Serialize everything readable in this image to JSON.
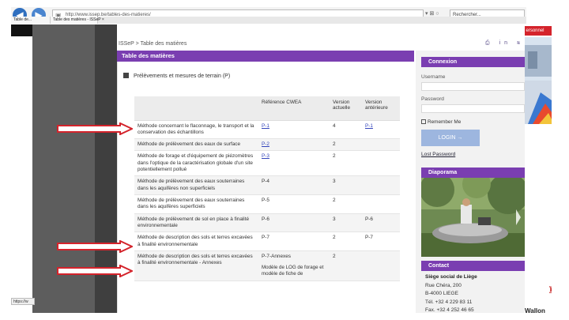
{
  "browser": {
    "back_icon": "back-arrow-icon",
    "forward_icon": "forward-arrow-icon",
    "address": "http://www.issep.be/tables-des-matieres/",
    "address_tools": "▾ ⊠ ○",
    "search_text": "Rechercher...",
    "tabs": [
      {
        "label": "Table de..."
      },
      {
        "label": "Table des matières - ISSeP ×"
      }
    ],
    "status_url": "https://w",
    "ribbon_text": "ersonnel"
  },
  "page": {
    "breadcrumb": "ISSeP > Table des matières",
    "tools_icons": [
      "print-icon",
      "linkedin-icon",
      "rss-icon",
      "search-icon"
    ],
    "tools_text": "⎙ in ≋ ⌕",
    "title": "Table des matières",
    "section_title": "Prélèvements et mesures de terrain (P)",
    "table": {
      "headers": [
        "",
        "Référence CWEA",
        "Version actuelle",
        "Version antérieure"
      ],
      "rows": [
        {
          "desc": "Méthode concernant le flaconnage, le transport et la conservation des échantillons",
          "ref": "P-1",
          "ref_link": true,
          "cur": "4",
          "prev": "P-1",
          "prev_link": true
        },
        {
          "desc": "Méthode de prélèvement des eaux de surface",
          "ref": "P-2",
          "ref_link": true,
          "cur": "2",
          "prev": ""
        },
        {
          "desc": "Méthode de forage et d'équipement de piézomètres dans l'optique de la caractérisation globale d'un site potentiellement pollué",
          "ref": "P-3",
          "ref_link": true,
          "cur": "2",
          "prev": ""
        },
        {
          "desc": "Méthode de prélèvement des eaux souterraines dans les aquifères non superficiels",
          "ref": "P-4",
          "ref_link": false,
          "cur": "3",
          "prev": ""
        },
        {
          "desc": "Méthode de prélèvement des eaux souterraines dans les aquifères superficiels",
          "ref": "P-5",
          "ref_link": false,
          "cur": "2",
          "prev": ""
        },
        {
          "desc": "Méthode de prélèvement de sol en place à finalité environnementale",
          "ref": "P-6",
          "ref_link": false,
          "cur": "3",
          "prev": "P-6"
        },
        {
          "desc": "Méthode de description des sols et terres excavées à finalité environnementale",
          "ref": "P-7",
          "ref_link": false,
          "cur": "2",
          "prev": "P-7"
        },
        {
          "desc": "Méthode de description des sols et terres excavées à finalité environnementale - Annexes",
          "ref": "P-7-Annexes",
          "ref_link": false,
          "cur": "2",
          "prev": "",
          "note": "Modèle de LOG de forage et modèle de fiche de"
        }
      ]
    }
  },
  "sidebar": {
    "login_title": "Connexion",
    "username_label": "Username",
    "password_label": "Password",
    "remember_label": "Remember Me",
    "login_button": "LOGIN →",
    "lost_password": "Lost Password",
    "diaporama_title": "Diaporama",
    "contact_title": "Contact",
    "contact": {
      "name": "Siège social de Liège",
      "street": "Rue Chéra, 200",
      "city": "B-4000 LIEGE",
      "tel": "Tél. +32 4 229 83 11",
      "fax": "Fax. +32 4 252 46 65"
    }
  },
  "far_right": {
    "wallonie": "Wallon"
  },
  "colors": {
    "accent": "#7a3eb1",
    "arrow": "#d4232b",
    "link": "#3344bb",
    "login_button": "#9db6df"
  }
}
